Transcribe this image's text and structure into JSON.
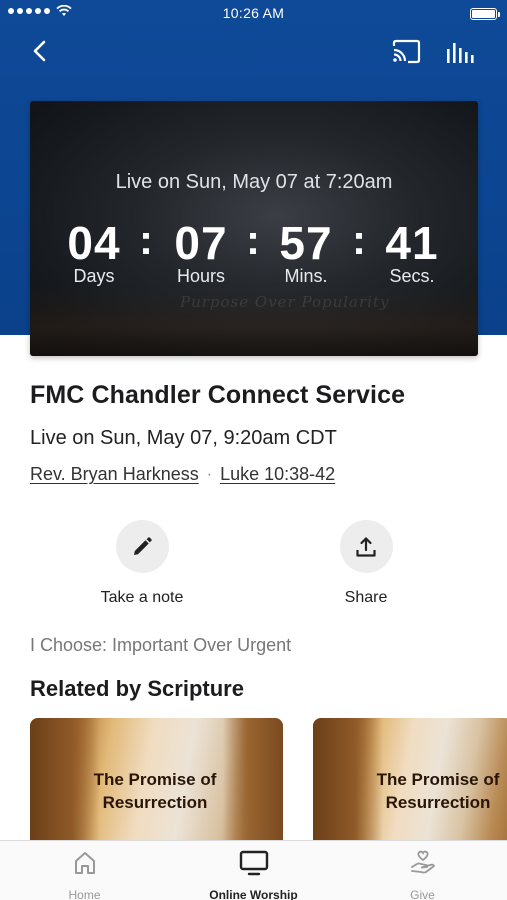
{
  "status_bar": {
    "time": "10:26 AM"
  },
  "header": {
    "back_icon": "chevron-left-icon",
    "cast_icon": "cast-icon",
    "levels_icon": "audio-levels-icon"
  },
  "live_card": {
    "subtitle": "Live on Sun, May 07 at 7:20am",
    "watermark": "Purpose Over Popularity",
    "countdown": [
      {
        "value": "04",
        "unit": "Days"
      },
      {
        "value": "07",
        "unit": "Hours"
      },
      {
        "value": "57",
        "unit": "Mins."
      },
      {
        "value": "41",
        "unit": "Secs."
      }
    ],
    "separator": ":"
  },
  "service": {
    "title": "FMC Chandler Connect Service",
    "time": "Live on Sun, May 07, 9:20am CDT",
    "speaker": "Rev. Bryan Harkness",
    "separator": "·",
    "scripture": "Luke 10:38-42"
  },
  "actions": {
    "note_label": "Take a note",
    "share_label": "Share"
  },
  "series_text": "I Choose:  Important Over Urgent",
  "related": {
    "title": "Related by Scripture",
    "cards": [
      {
        "label_line1": "The Promise of",
        "label_line2": "Resurrection"
      },
      {
        "label_line1": "The Promise of",
        "label_line2": "Resurrection"
      }
    ]
  },
  "tab_bar": {
    "tabs": [
      {
        "label": "Home",
        "icon": "home-icon",
        "active": false
      },
      {
        "label": "Online Worship",
        "icon": "tv-icon",
        "active": true
      },
      {
        "label": "Give",
        "icon": "give-hand-heart-icon",
        "active": false
      }
    ]
  },
  "colors": {
    "header_blue": "#0d4693",
    "card_dark": "#1a1d21",
    "text_primary": "#1c1c1e",
    "text_muted": "#777777",
    "action_circle": "#ededed"
  }
}
